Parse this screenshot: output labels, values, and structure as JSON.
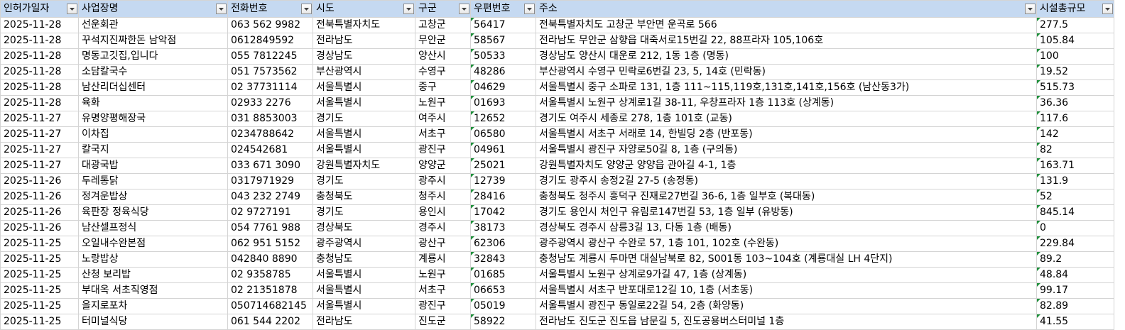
{
  "headers": [
    "인허가일자",
    "사업장명",
    "전화번호",
    "시도",
    "구군",
    "우편번호",
    "주소",
    "시설총규모"
  ],
  "rows": [
    [
      "2025-11-28",
      "선운회관",
      "063 562 9982",
      "전북특별자치도",
      "고창군",
      "56417",
      "전북특별자치도 고창군 부안면 운곡로 566",
      "277.5"
    ],
    [
      "2025-11-28",
      "꾸석지진짜한돈 남악점",
      "0612849592",
      "전라남도",
      "무안군",
      "58567",
      "전라남도 무안군 삼향읍 대죽서로15번길 22, 88프라자 105,106호",
      "105.84"
    ],
    [
      "2025-11-28",
      "명동고깃집,입니다",
      "055 7812245",
      "경상남도",
      "양산시",
      "50533",
      "경상남도 양산시 대운로 212, 1동 1층 (명동)",
      "100"
    ],
    [
      "2025-11-28",
      "소담칼국수",
      "051 7573562",
      "부산광역시",
      "수영구",
      "48286",
      "부산광역시 수영구 민락로6번길 23, 5, 14호 (민락동)",
      "19.52"
    ],
    [
      "2025-11-28",
      "남산리더십센터",
      "02  37731114",
      "서울특별시",
      "중구",
      "04629",
      "서울특별시 중구 소파로 131, 1층 111~115,119호,131호,141호,156호 (남산동3가)",
      "515.73"
    ],
    [
      "2025-11-28",
      "육화",
      "02933 2276",
      "서울특별시",
      "노원구",
      "01693",
      "서울특별시 노원구 상계로1길 38-11, 우창프라자 1층 113호 (상계동)",
      "36.36"
    ],
    [
      "2025-11-27",
      "유명양평해장국",
      "031 8853003",
      "경기도",
      "여주시",
      "12652",
      "경기도 여주시 세종로 278, 1층 101호 (교동)",
      "117.6"
    ],
    [
      "2025-11-27",
      "이차집",
      "0234788642",
      "서울특별시",
      "서초구",
      "06580",
      "서울특별시 서초구 서래로 14, 한빌딩 2층 (반포동)",
      "142"
    ],
    [
      "2025-11-27",
      "칼국지",
      "024542681",
      "서울특별시",
      "광진구",
      "04961",
      "서울특별시 광진구 자양로50길 8, 1층 (구의동)",
      "82"
    ],
    [
      "2025-11-27",
      "대광국밥",
      "033 671 3090",
      "강원특별자치도",
      "양양군",
      "25021",
      "강원특별자치도 양양군 양양읍 관아길 4-1, 1층",
      "163.71"
    ],
    [
      "2025-11-26",
      "두레통닭",
      "0317971929",
      "경기도",
      "광주시",
      "12739",
      "경기도 광주시 송정2길 27-5 (송정동)",
      "131.9"
    ],
    [
      "2025-11-26",
      "정겨운밥상",
      "043 232 2749",
      "충청북도",
      "청주시",
      "28416",
      "충청북도 청주시 흥덕구 진재로27번길 36-6, 1층 일부호 (복대동)",
      "52"
    ],
    [
      "2025-11-26",
      "육판장 정육식당",
      "02 9727191",
      "경기도",
      "용인시",
      "17042",
      "경기도 용인시 처인구 유림로147번길 53, 1층 일부 (유방동)",
      "845.14"
    ],
    [
      "2025-11-26",
      "남산셀프정식",
      "054 7761 988",
      "경상북도",
      "경주시",
      "38173",
      "경상북도 경주시 삼릉3길 13, 다동 1층 (배동)",
      "0"
    ],
    [
      "2025-11-25",
      "오일내수완본점",
      "062 951 5152",
      "광주광역시",
      "광산구",
      "62306",
      "광주광역시 광산구 수완로 57, 1층 101, 102호 (수완동)",
      "229.84"
    ],
    [
      "2025-11-25",
      "노랑밥상",
      "042840 8890",
      "충청남도",
      "계룡시",
      "32843",
      "충청남도 계룡시 두마면 대실남북로 82, S001동 103~104호 (계룡대실 LH 4단지)",
      "89.2"
    ],
    [
      "2025-11-25",
      "산청 보리밥",
      "02 9358785",
      "서울특별시",
      "노원구",
      "01685",
      "서울특별시 노원구 상계로9가길 47, 1층 (상계동)",
      "48.84"
    ],
    [
      "2025-11-25",
      "부대옥 서초직영점",
      "02  21351878",
      "서울특별시",
      "서초구",
      "06653",
      "서울특별시 서초구 반포대로12길 10, 1층 (서초동)",
      "99.17"
    ],
    [
      "2025-11-25",
      "을지로포차",
      "050714682145",
      "서울특별시",
      "광진구",
      "05019",
      "서울특별시 광진구 동일로22길 54, 2층 (화양동)",
      "82.89"
    ],
    [
      "2025-11-25",
      "터미널식당",
      "061 544 2202",
      "전라남도",
      "진도군",
      "58922",
      "전라남도 진도군 진도읍 남문길 5, 진도공용버스터미널 1층",
      "41.55"
    ]
  ],
  "colors": {
    "header_bg": "#c5d9f1",
    "grid": "#d4d4d4",
    "error_triangle": "#1e8f3a"
  },
  "icons": {
    "filter": "filter-dropdown-icon",
    "error": "text-number-indicator-icon"
  }
}
